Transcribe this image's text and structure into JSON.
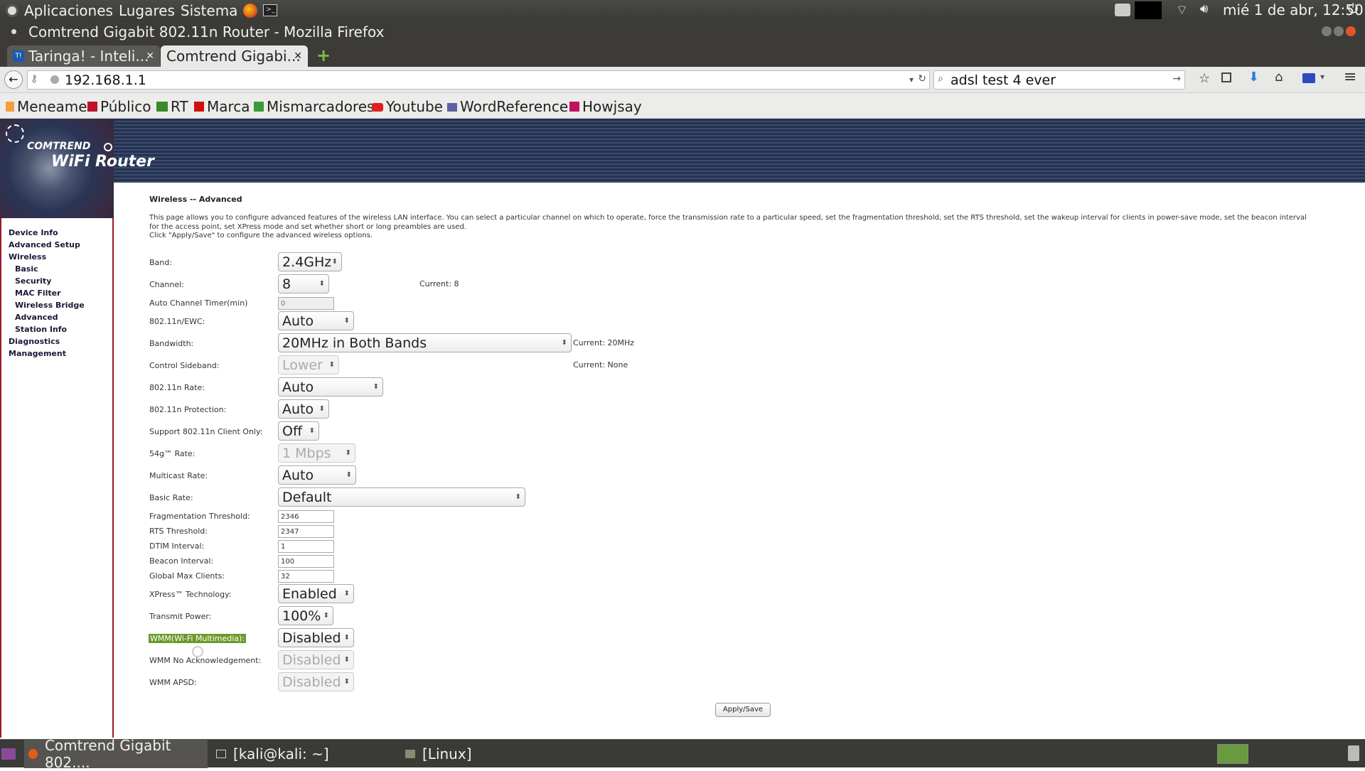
{
  "topbar": {
    "menu_apps": "Aplicaciones",
    "menu_places": "Lugares",
    "menu_system": "Sistema",
    "clock": "mié  1 de abr, 12:50"
  },
  "window": {
    "title": "Comtrend Gigabit 802.11n Router - Mozilla Firefox"
  },
  "tabs": [
    {
      "label": "Taringa! - Inteli..."
    },
    {
      "label": "Comtrend Gigabi..."
    }
  ],
  "nav": {
    "url": "192.168.1.1",
    "search": "adsl test 4 ever"
  },
  "bookmarks": [
    {
      "label": "Meneame",
      "icon": "#f0a040"
    },
    {
      "label": "Público",
      "icon": "#c0102a"
    },
    {
      "label": "RT",
      "icon": "#3a8a2a"
    },
    {
      "label": "Marca",
      "icon": "#d01010"
    },
    {
      "label": "Mismarcadores",
      "icon": "#3a9a3a"
    },
    {
      "label": "Youtube",
      "icon": "#e02020"
    },
    {
      "label": "WordReference",
      "icon": "#6060a0"
    },
    {
      "label": "Howjsay",
      "icon": "#c01060"
    }
  ],
  "router": {
    "logo_brand": "COMTREND",
    "logo_product": "WiFi Router",
    "menu": {
      "device_info": "Device Info",
      "advanced_setup": "Advanced Setup",
      "wireless": "Wireless",
      "basic": "Basic",
      "security": "Security",
      "mac_filter": "MAC Filter",
      "wireless_bridge": "Wireless Bridge",
      "advanced": "Advanced",
      "station_info": "Station Info",
      "diagnostics": "Diagnostics",
      "management": "Management"
    },
    "page_title": "Wireless -- Advanced",
    "description": "This page allows you to configure advanced features of the wireless LAN interface. You can select a particular channel on which to operate, force the transmission rate to a particular speed, set the fragmentation threshold, set the RTS threshold, set the wakeup interval for clients in power-save mode, set the beacon interval for the access point, set XPress mode and set whether short or long preambles are used.",
    "description2": "Click \"Apply/Save\" to configure the advanced wireless options.",
    "fields": {
      "band": {
        "label": "Band:",
        "value": "2.4GHz"
      },
      "channel": {
        "label": "Channel:",
        "value": "8",
        "current": "Current: 8"
      },
      "auto_channel_timer": {
        "label": "Auto Channel Timer(min)",
        "value": "0"
      },
      "n_ewc": {
        "label": "802.11n/EWC:",
        "value": "Auto"
      },
      "bandwidth": {
        "label": "Bandwidth:",
        "value": "20MHz in Both Bands",
        "current": "Current: 20MHz"
      },
      "control_sideband": {
        "label": "Control Sideband:",
        "value": "Lower",
        "current": "Current: None"
      },
      "n_rate": {
        "label": "802.11n Rate:",
        "value": "Auto"
      },
      "n_protection": {
        "label": "802.11n Protection:",
        "value": "Auto"
      },
      "n_client_only": {
        "label": "Support 802.11n Client Only:",
        "value": "Off"
      },
      "g_rate": {
        "label": "54g™ Rate:",
        "value": "1 Mbps"
      },
      "multicast_rate": {
        "label": "Multicast Rate:",
        "value": "Auto"
      },
      "basic_rate": {
        "label": "Basic Rate:",
        "value": "Default"
      },
      "frag_threshold": {
        "label": "Fragmentation Threshold:",
        "value": "2346"
      },
      "rts_threshold": {
        "label": "RTS Threshold:",
        "value": "2347"
      },
      "dtim": {
        "label": "DTIM Interval:",
        "value": "1"
      },
      "beacon": {
        "label": "Beacon Interval:",
        "value": "100"
      },
      "max_clients": {
        "label": "Global Max Clients:",
        "value": "32"
      },
      "xpress": {
        "label": "XPress™ Technology:",
        "value": "Enabled"
      },
      "tx_power": {
        "label": "Transmit Power:",
        "value": "100%"
      },
      "wmm": {
        "label": "WMM(Wi-Fi Multimedia):",
        "value": "Disabled"
      },
      "wmm_noack": {
        "label": "WMM No Acknowledgement:",
        "value": "Disabled"
      },
      "wmm_apsd": {
        "label": "WMM APSD:",
        "value": "Disabled"
      }
    },
    "apply_button": "Apply/Save"
  },
  "taskbar": {
    "firefox": "Comtrend Gigabit 802....",
    "terminal": "[kali@kali: ~]",
    "folder": "[Linux]"
  },
  "colors": {
    "wmm_highlight": "#6a9a2a",
    "router_red": "#a0162a"
  }
}
